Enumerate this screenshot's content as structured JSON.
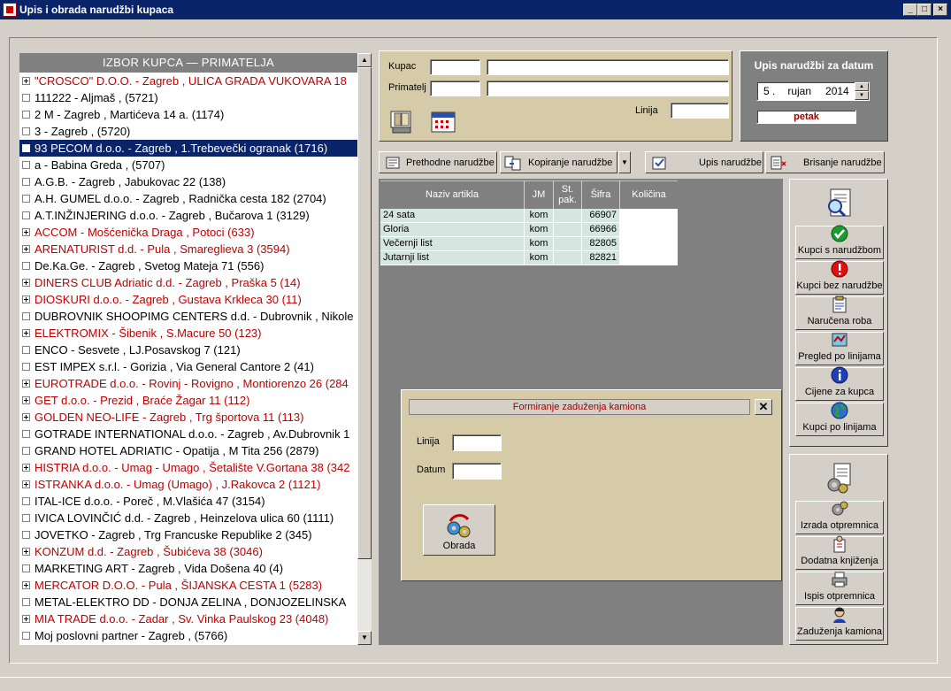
{
  "window": {
    "title": "Upis i obrada narudžbi kupaca"
  },
  "customer_list": {
    "header": "IZBOR KUPCA — PRIMATELJA",
    "items": [
      {
        "label": "\"CROSCO\" D.O.O. - Zagreb , ULICA GRADA VUKOVARA 18",
        "expand": true,
        "red": true
      },
      {
        "label": "111222 - Aljmaš ,    (5721)",
        "expand": false,
        "red": false
      },
      {
        "label": "2 M - Zagreb , Martićeva 14 a.  (1174)",
        "expand": false,
        "red": false
      },
      {
        "label": "3 - Zagreb ,    (5720)",
        "expand": false,
        "red": false
      },
      {
        "label": "93 PECOM d.o.o. - Zagreb , 1.Trebevečki ogranak  (1716)",
        "expand": false,
        "red": false,
        "selected": true
      },
      {
        "label": "a - Babina Greda ,    (5707)",
        "expand": false,
        "red": false
      },
      {
        "label": "A.G.B. - Zagreb , Jabukovac 22  (138)",
        "expand": false,
        "red": false
      },
      {
        "label": "A.H. GUMEL d.o.o. - Zagreb , Radnička cesta 182  (2704)",
        "expand": false,
        "red": false
      },
      {
        "label": "A.T.INŽINJERING d.o.o. - Zagreb , Bučarova 1  (3129)",
        "expand": false,
        "red": false
      },
      {
        "label": "ACCOM - Mošćenička Draga , Potoci   (633)",
        "expand": true,
        "red": true
      },
      {
        "label": "ARENATURIST d.d. - Pula , Smareglieva 3  (3594)",
        "expand": true,
        "red": true
      },
      {
        "label": "De.Ka.Ge. - Zagreb , Svetog Mateja 71  (556)",
        "expand": false,
        "red": false
      },
      {
        "label": "DINERS CLUB Adriatic d.d. - Zagreb , Praška 5  (14)",
        "expand": true,
        "red": true
      },
      {
        "label": "DIOSKURI d.o.o. - Zagreb , Gustava Krkleca 30  (11)",
        "expand": true,
        "red": true
      },
      {
        "label": "DUBROVNIK SHOOPIMG CENTERS d.d. - Dubrovnik , Nikole",
        "expand": false,
        "red": false
      },
      {
        "label": "ELEKTROMIX - Šibenik , S.Macure 50  (123)",
        "expand": true,
        "red": true
      },
      {
        "label": "ENCO - Sesvete , LJ.Posavskog 7  (121)",
        "expand": false,
        "red": false
      },
      {
        "label": "EST IMPEX s.r.l. - Gorizia , Via General Cantore 2  (41)",
        "expand": false,
        "red": false
      },
      {
        "label": "EUROTRADE d.o.o. - Rovinj - Rovigno , Montiorenzo 26  (284",
        "expand": true,
        "red": true
      },
      {
        "label": "GET d.o.o. - Prezid , Braće Žagar 11  (112)",
        "expand": true,
        "red": true
      },
      {
        "label": "GOLDEN NEO-LIFE - Zagreb , Trg športova 11  (113)",
        "expand": true,
        "red": true
      },
      {
        "label": "GOTRADE INTERNATIONAL d.o.o. - Zagreb , Av.Dubrovnik 1",
        "expand": false,
        "red": false
      },
      {
        "label": "GRAND HOTEL ADRIATIC - Opatija , M Tita 256  (2879)",
        "expand": false,
        "red": false
      },
      {
        "label": "HISTRIA d.o.o. - Umag - Umago , Šetalište V.Gortana 38  (342",
        "expand": true,
        "red": true
      },
      {
        "label": "ISTRANKA d.o.o. - Umag (Umago) , J.Rakovca 2  (1121)",
        "expand": true,
        "red": true
      },
      {
        "label": "ITAL-ICE d.o.o. - Poreč , M.Vlašića 47  (3154)",
        "expand": false,
        "red": false
      },
      {
        "label": "IVICA LOVINČIĆ d.d. - Zagreb , Heinzelova ulica 60  (1111)",
        "expand": false,
        "red": false
      },
      {
        "label": "JOVETKO - Zagreb , Trg Francuske Republike 2  (345)",
        "expand": false,
        "red": false
      },
      {
        "label": "KONZUM d.d. - Zagreb , Šubićeva 38  (3046)",
        "expand": true,
        "red": true
      },
      {
        "label": "MARKETING ART - Zagreb , Vida Došena 40  (4)",
        "expand": false,
        "red": false
      },
      {
        "label": "MERCATOR D.O.O. - Pula , ŠIJANSKA CESTA 1  (5283)",
        "expand": true,
        "red": true
      },
      {
        "label": "METAL-ELEKTRO   DD - DONJA ZELINA , DONJOZELINSKA",
        "expand": false,
        "red": false
      },
      {
        "label": "MIA TRADE d.o.o. - Zadar , Sv. Vinka Paulskog 23  (4048)",
        "expand": true,
        "red": true
      },
      {
        "label": "Moj poslovni partner - Zagreb ,    (5766)",
        "expand": false,
        "red": false
      }
    ]
  },
  "customer_form": {
    "kupac_label": "Kupac",
    "primatelj_label": "Primatelj",
    "linija_label": "Linija"
  },
  "date_panel": {
    "title": "Upis narudžbi za datum",
    "day": "5 .",
    "month": "rujan",
    "year": "2014",
    "weekday": "petak"
  },
  "toolbar": {
    "previous_orders": "Prethodne narudžbe",
    "copy_order": "Kopiranje narudžbe",
    "enter_order": "Upis narudžbe",
    "delete_order": "Brisanje narudžbe"
  },
  "grid": {
    "columns": [
      "Naziv artikla",
      "JM",
      "St. pak.",
      "Šifra",
      "Količina"
    ],
    "rows": [
      {
        "name": "24 sata",
        "jm": "kom",
        "pack": "",
        "code": "66907",
        "qty": ""
      },
      {
        "name": "Gloria",
        "jm": "kom",
        "pack": "",
        "code": "66966",
        "qty": ""
      },
      {
        "name": "Večernji list",
        "jm": "kom",
        "pack": "",
        "code": "82805",
        "qty": ""
      },
      {
        "name": "Jutarnji list",
        "jm": "kom",
        "pack": "",
        "code": "82821",
        "qty": ""
      }
    ]
  },
  "side_buttons": {
    "group1": [
      {
        "label": "Kupci s narudžbom",
        "icon": "green-check-icon"
      },
      {
        "label": "Kupci bez narudžbe",
        "icon": "red-exclamation-icon"
      },
      {
        "label": "Naručena roba",
        "icon": "notepad-icon"
      },
      {
        "label": "Pregled po linijama",
        "icon": "map-icon"
      },
      {
        "label": "Cijene za kupca",
        "icon": "info-icon"
      },
      {
        "label": "Kupci po linijama",
        "icon": "globe-icon"
      }
    ],
    "group2": [
      {
        "label": "Izrada otpremnica",
        "icon": "gears-icon"
      },
      {
        "label": "Dodatna knjiženja",
        "icon": "book-person-icon"
      },
      {
        "label": "Ispis otpremnica",
        "icon": "printer-icon"
      },
      {
        "label": "Zaduženja kamiona",
        "icon": "user-icon"
      }
    ]
  },
  "dialog": {
    "title": "Formiranje zaduženja kamiona",
    "linija_label": "Linija",
    "datum_label": "Datum",
    "button": "Obrada"
  },
  "colors": {
    "title_bar": "#0a246a",
    "panel_tan": "#d6cba8",
    "red_text": "#c00000",
    "grid_cell": "#d7e5e0"
  }
}
